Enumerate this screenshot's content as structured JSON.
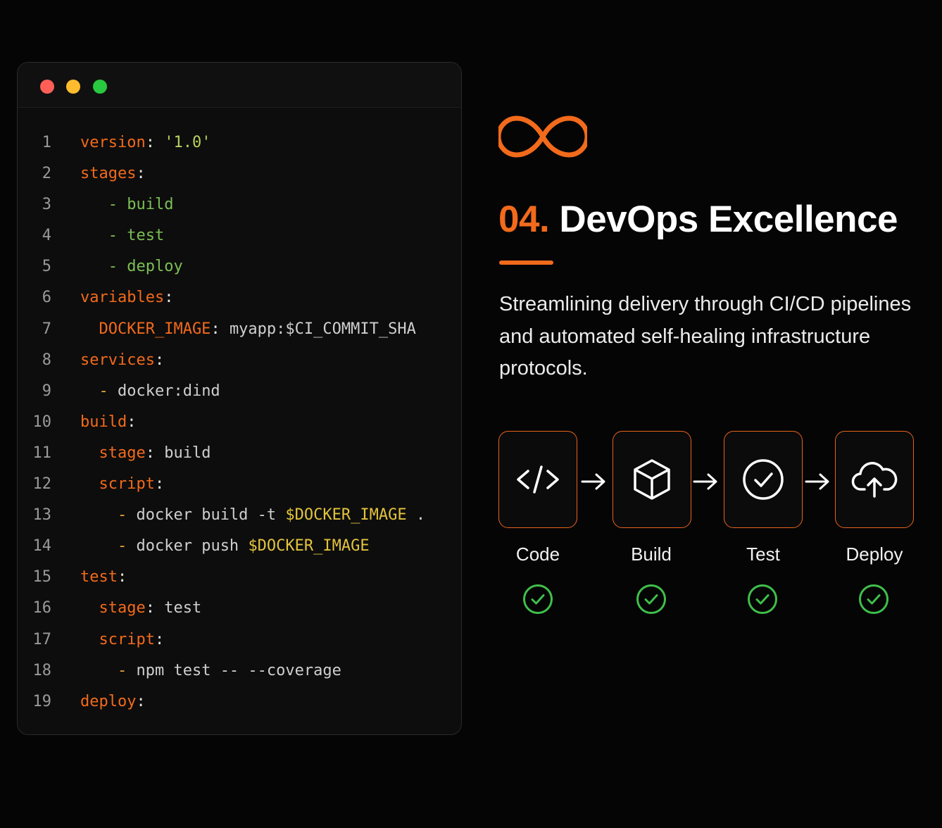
{
  "window": {
    "traffic_lights": [
      "red",
      "yellow",
      "green"
    ],
    "colors": {
      "red": "#ff5f57",
      "yellow": "#febc2e",
      "green": "#28c840"
    }
  },
  "code_lines": [
    {
      "n": "1",
      "text": "version: '1.0'"
    },
    {
      "n": "2",
      "text": "stages:"
    },
    {
      "n": "3",
      "text": "   - build"
    },
    {
      "n": "4",
      "text": "   - test"
    },
    {
      "n": "5",
      "text": "   - deploy"
    },
    {
      "n": "6",
      "text": "variables:"
    },
    {
      "n": "7",
      "text": "  DOCKER_IMAGE: myapp:$CI_COMMIT_SHA"
    },
    {
      "n": "8",
      "text": "services:"
    },
    {
      "n": "9",
      "text": "  - docker:dind"
    },
    {
      "n": "10",
      "text": "build:"
    },
    {
      "n": "11",
      "text": "  stage: build"
    },
    {
      "n": "12",
      "text": "  script:"
    },
    {
      "n": "13",
      "text": "    - docker build -t $DOCKER_IMAGE ."
    },
    {
      "n": "14",
      "text": "    - docker push $DOCKER_IMAGE"
    },
    {
      "n": "15",
      "text": "test:"
    },
    {
      "n": "16",
      "text": "  stage: test"
    },
    {
      "n": "17",
      "text": "  script:"
    },
    {
      "n": "18",
      "text": "    - npm test -- --coverage"
    },
    {
      "n": "19",
      "text": "deploy:"
    }
  ],
  "hero": {
    "icon": "infinity-icon",
    "number": "04.",
    "title": "DevOps Excellence",
    "description": "Streamlining delivery through CI/CD pipelines and automated self-healing infrastructure protocols."
  },
  "pipeline": {
    "stages": [
      {
        "label": "Code",
        "icon": "code-icon",
        "status": "complete"
      },
      {
        "label": "Build",
        "icon": "box-icon",
        "status": "complete"
      },
      {
        "label": "Test",
        "icon": "check-circle-icon",
        "status": "complete"
      },
      {
        "label": "Deploy",
        "icon": "cloud-upload-icon",
        "status": "complete"
      }
    ]
  },
  "colors": {
    "accent": "#f26a1b",
    "success": "#3fbf4a",
    "background": "#050505",
    "keyword": "#f26a1b",
    "string_value": "#7cbf55",
    "variable": "#e3c33c"
  }
}
